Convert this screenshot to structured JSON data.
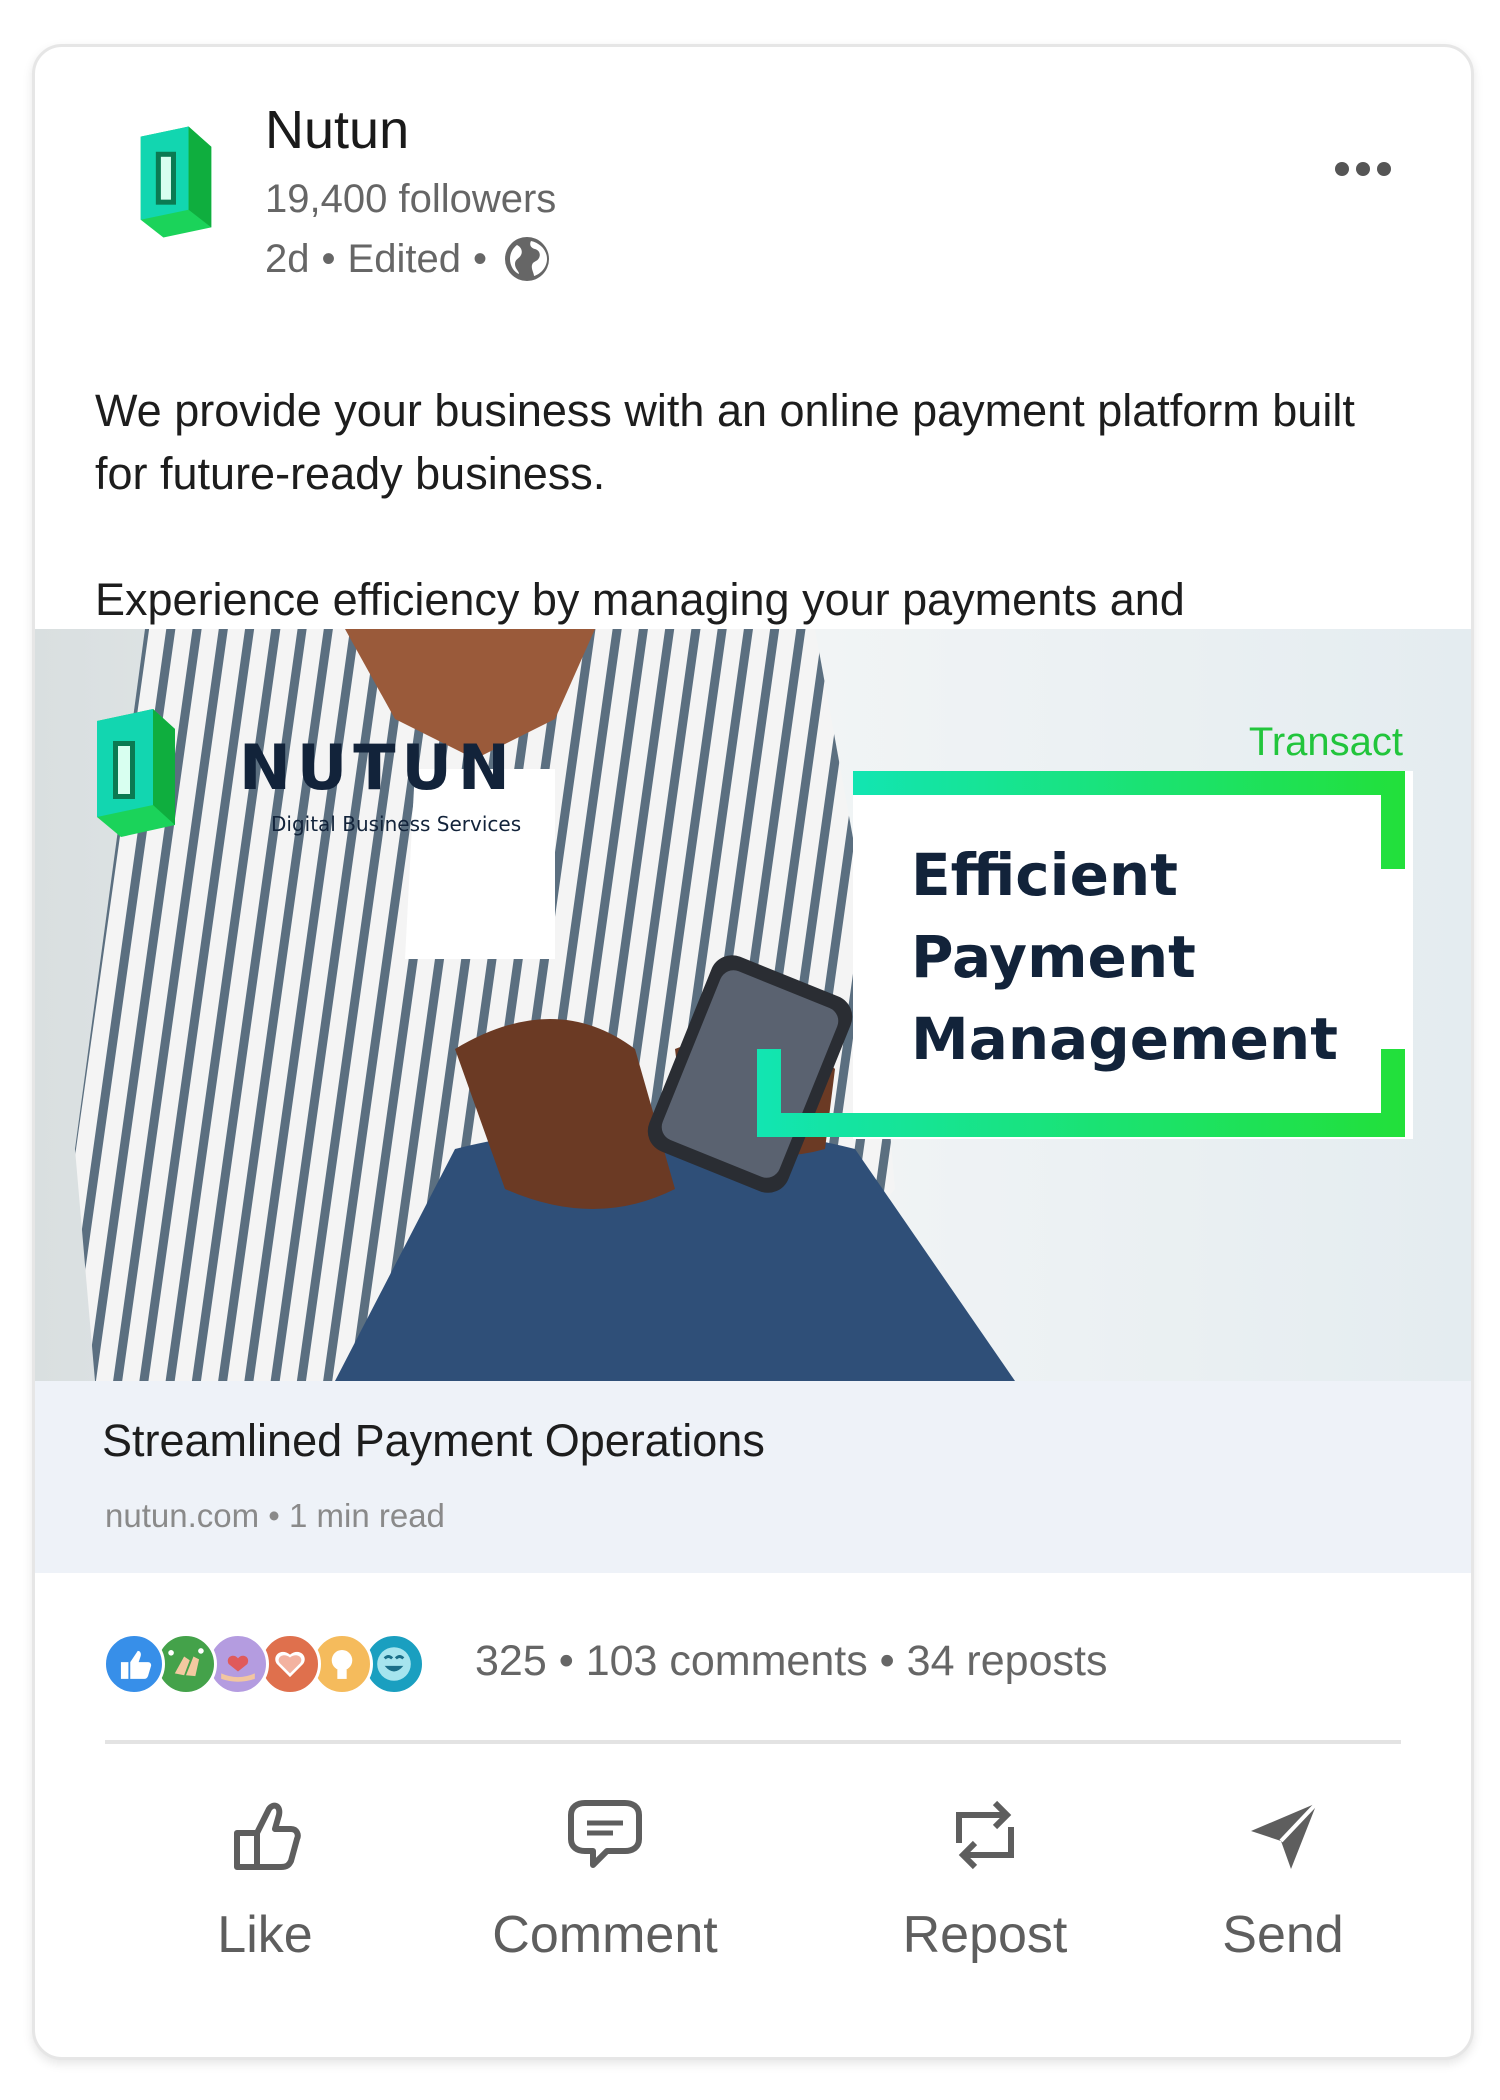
{
  "post": {
    "company_name": "Nutun",
    "followers": "19,400 followers",
    "age": "2d",
    "edited": "Edited",
    "separator": "•",
    "body_line1": "We provide your business with an online payment platform built for future-ready business.",
    "body_line2": "Experience efficiency by managing your payments and"
  },
  "hero": {
    "brand_wordmark": "NUTUN",
    "brand_tagline": "Digital Business Services",
    "product_label": "Transact",
    "headline_line1": "Efficient",
    "headline_line2": "Payment",
    "headline_line3": "Management"
  },
  "link": {
    "title": "Streamlined Payment Operations",
    "meta": "nutun.com • 1 min read"
  },
  "social": {
    "counts": "325 • 103 comments • 34 reposts",
    "reactions": [
      "like-icon",
      "celebrate-icon",
      "support-icon",
      "love-icon",
      "insightful-icon",
      "funny-icon"
    ]
  },
  "actions": {
    "like": "Like",
    "comment": "Comment",
    "repost": "Repost",
    "send": "Send"
  },
  "colors": {
    "brand_green": "#1ee04a",
    "brand_teal": "#12d6b0",
    "text_muted": "#666666",
    "link_bar_bg": "#eef2f8"
  }
}
